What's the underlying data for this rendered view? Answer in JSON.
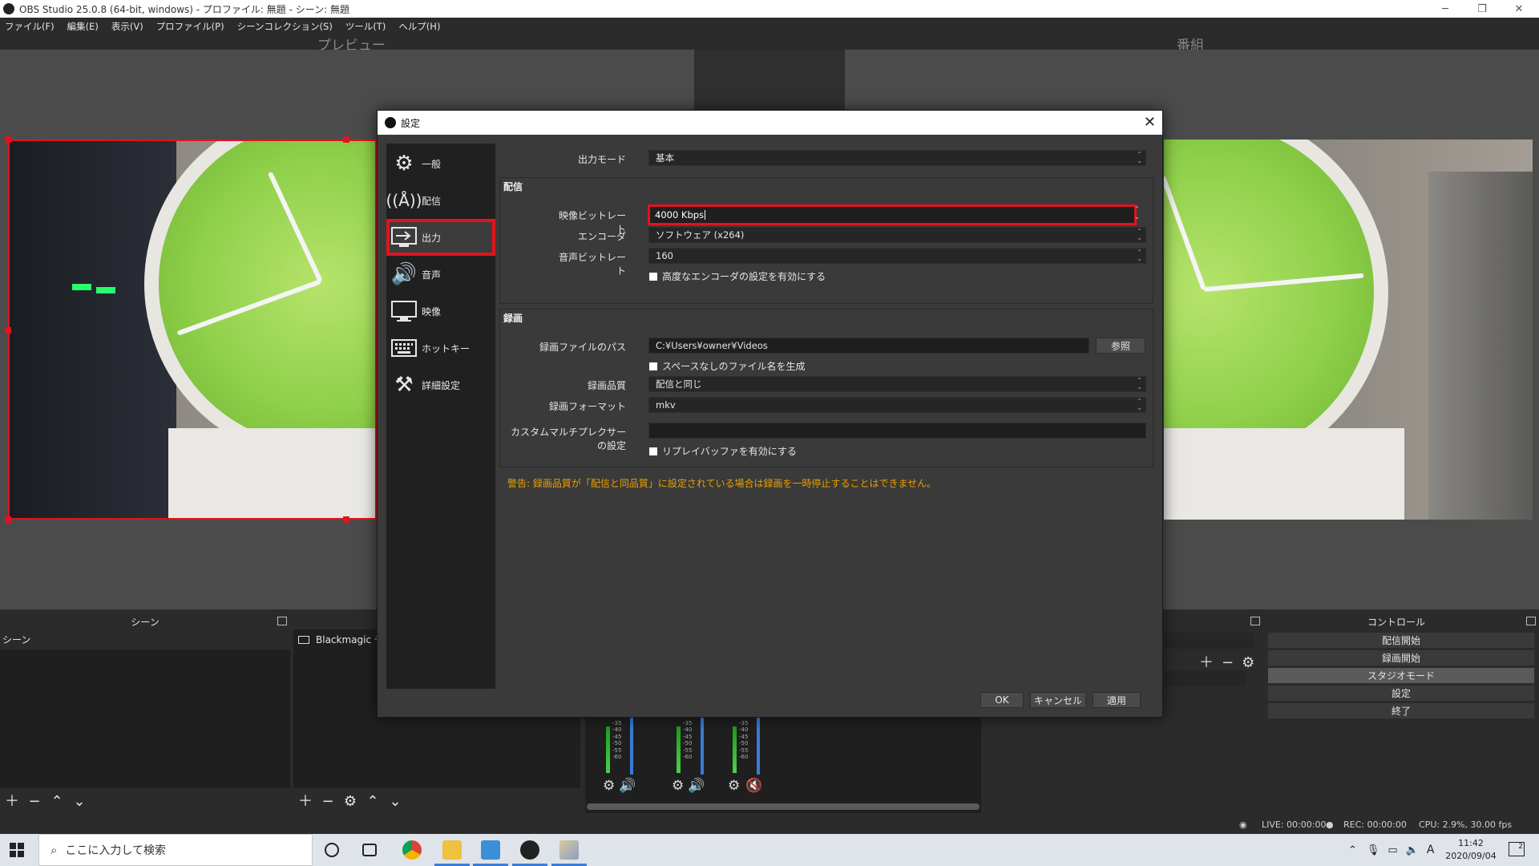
{
  "window": {
    "title": "OBS Studio 25.0.8 (64-bit, windows) - プロファイル: 無題 - シーン: 無題",
    "controls": [
      "─",
      "❐",
      "✕"
    ]
  },
  "menu": [
    "ファイル(F)",
    "編集(E)",
    "表示(V)",
    "プロファイル(P)",
    "シーンコレクション(S)",
    "ツール(T)",
    "ヘルプ(H)"
  ],
  "panes": {
    "preview_label": "プレビュー",
    "program_label": "番組"
  },
  "docks": {
    "scenes": {
      "title": "シーン",
      "items": [
        "シーン"
      ]
    },
    "sources": {
      "items": [
        "Blackmagic デ"
      ]
    },
    "controls": {
      "title": "コントロール",
      "buttons": [
        "配信開始",
        "録画開始",
        "スタジオモード",
        "設定",
        "終了"
      ],
      "active_index": 2
    }
  },
  "mixer": {
    "scale": [
      "-35",
      "-40",
      "-45",
      "-50",
      "-55",
      "-60"
    ]
  },
  "status": {
    "live": "LIVE: 00:00:00",
    "rec": "REC: 00:00:00",
    "cpu": "CPU: 2.9%, 30.00 fps"
  },
  "taskbar": {
    "search_placeholder": "ここに入力して検索",
    "time": "11:42",
    "date": "2020/09/04",
    "ime": "A",
    "notification_count": "2"
  },
  "settings": {
    "title": "設定",
    "nav": [
      {
        "label": "一般",
        "icon": "gear-icon"
      },
      {
        "label": "配信",
        "icon": "antenna-icon"
      },
      {
        "label": "出力",
        "icon": "output-icon"
      },
      {
        "label": "音声",
        "icon": "speaker-icon"
      },
      {
        "label": "映像",
        "icon": "monitor-icon"
      },
      {
        "label": "ホットキー",
        "icon": "keyboard-icon"
      },
      {
        "label": "詳細設定",
        "icon": "tools-icon"
      }
    ],
    "selected_nav": 2,
    "output_mode_label": "出力モード",
    "output_mode_value": "基本",
    "streaming": {
      "title": "配信",
      "video_bitrate_label": "映像ビットレート",
      "video_bitrate_value": "4000 Kbps",
      "encoder_label": "エンコーダ",
      "encoder_value": "ソフトウェア (x264)",
      "audio_bitrate_label": "音声ビットレート",
      "audio_bitrate_value": "160",
      "advanced_checkbox": "高度なエンコーダの設定を有効にする"
    },
    "recording": {
      "title": "録画",
      "path_label": "録画ファイルのパス",
      "path_value": "C:¥Users¥owner¥Videos",
      "browse_button": "参照",
      "nospace_checkbox": "スペースなしのファイル名を生成",
      "quality_label": "録画品質",
      "quality_value": "配信と同じ",
      "format_label": "録画フォーマット",
      "format_value": "mkv",
      "muxer_label": "カスタムマルチプレクサーの設定",
      "muxer_value": "",
      "replay_checkbox": "リプレイバッファを有効にする"
    },
    "warning": "警告: 録画品質が「配信と同品質」に設定されている場合は録画を一時停止することはできません。",
    "buttons": {
      "ok": "OK",
      "cancel": "キャンセル",
      "apply": "適用"
    }
  },
  "colors": {
    "accent_red": "#e0141e",
    "warning": "#e8a000",
    "panel": "#3a3a3a",
    "background": "#2b2b2b"
  }
}
